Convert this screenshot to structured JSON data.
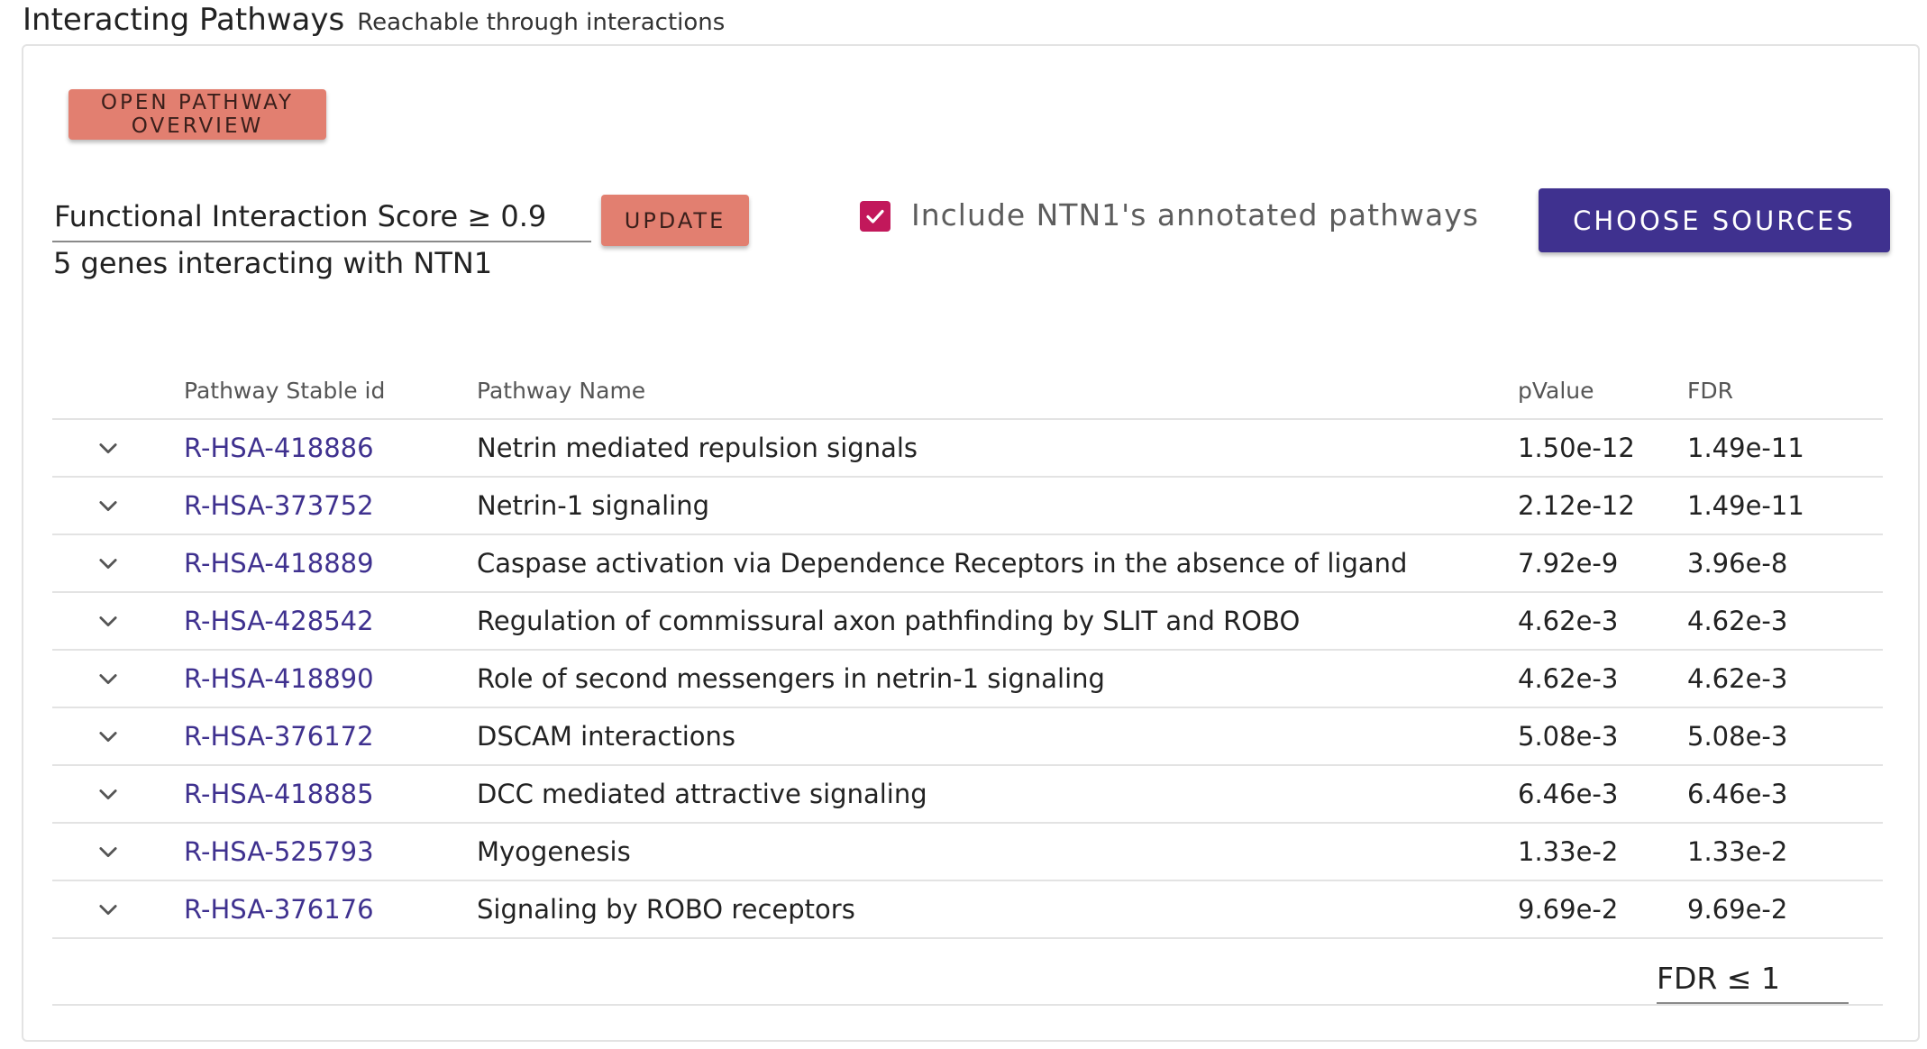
{
  "section": {
    "title": "Interacting Pathways",
    "subtitle": "Reachable through interactions"
  },
  "toolbar": {
    "overview_label": "OPEN PATHWAY OVERVIEW",
    "score_text": "Functional Interaction Score ≥ 0.9",
    "update_label": "UPDATE",
    "genes_text": "5 genes interacting with NTN1",
    "include_checked": true,
    "include_label": "Include NTN1's annotated pathways",
    "sources_label": "CHOOSE SOURCES"
  },
  "colors": {
    "accent_salmon": "#e27f70",
    "primary_indigo": "#3f318f",
    "checkbox": "#c2185b"
  },
  "table": {
    "headers": [
      "Pathway Stable id",
      "Pathway Name",
      "pValue",
      "FDR"
    ],
    "rows": [
      {
        "id": "R-HSA-418886",
        "name": "Netrin mediated repulsion signals",
        "pvalue": "1.50e-12",
        "fdr": "1.49e-11"
      },
      {
        "id": "R-HSA-373752",
        "name": "Netrin-1 signaling",
        "pvalue": "2.12e-12",
        "fdr": "1.49e-11"
      },
      {
        "id": "R-HSA-418889",
        "name": "Caspase activation via Dependence Receptors in the absence of ligand",
        "pvalue": "7.92e-9",
        "fdr": "3.96e-8"
      },
      {
        "id": "R-HSA-428542",
        "name": "Regulation of commissural axon pathfinding by SLIT and ROBO",
        "pvalue": "4.62e-3",
        "fdr": "4.62e-3"
      },
      {
        "id": "R-HSA-418890",
        "name": "Role of second messengers in netrin-1 signaling",
        "pvalue": "4.62e-3",
        "fdr": "4.62e-3"
      },
      {
        "id": "R-HSA-376172",
        "name": "DSCAM interactions",
        "pvalue": "5.08e-3",
        "fdr": "5.08e-3"
      },
      {
        "id": "R-HSA-418885",
        "name": "DCC mediated attractive signaling",
        "pvalue": "6.46e-3",
        "fdr": "6.46e-3"
      },
      {
        "id": "R-HSA-525793",
        "name": "Myogenesis",
        "pvalue": "1.33e-2",
        "fdr": "1.33e-2"
      },
      {
        "id": "R-HSA-376176",
        "name": "Signaling by ROBO receptors",
        "pvalue": "9.69e-2",
        "fdr": "9.69e-2"
      }
    ],
    "fdr_filter": "FDR ≤ 1"
  }
}
